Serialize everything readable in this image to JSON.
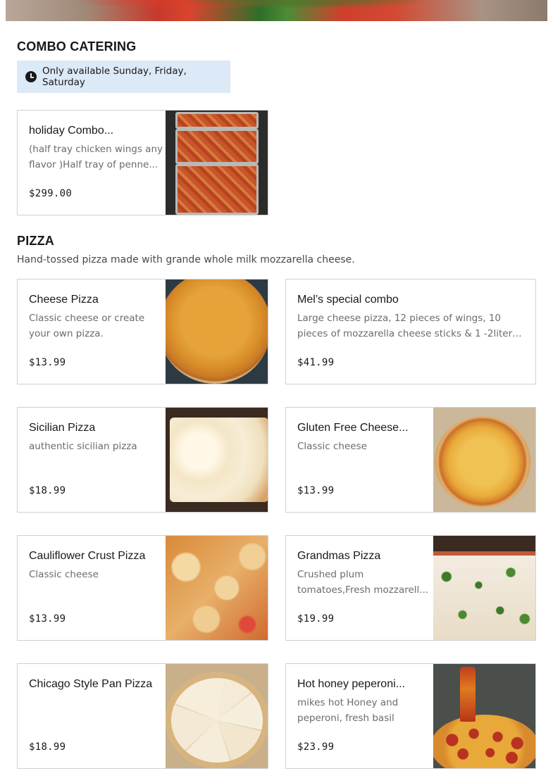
{
  "hero_image": "pizza-banner-image",
  "combo_section": {
    "title": "COMBO CATERING",
    "availability": "Only available Sunday, Friday, Saturday",
    "items": [
      {
        "name": "holiday Combo...",
        "desc": "(half tray chicken wings any flavor )Half tray of penne...",
        "price": "$299.00",
        "photo": "catering-trays-photo"
      }
    ]
  },
  "pizza_section": {
    "title": "PIZZA",
    "description": "Hand-tossed pizza made with grande whole milk mozzarella cheese.",
    "items": [
      {
        "name": "Cheese Pizza",
        "desc": "Classic cheese or create your own pizza.",
        "price": "$13.99",
        "photo": "cheese-pizza-photo"
      },
      {
        "name": "Mel’s special combo",
        "desc": "Large cheese pizza, 12 pieces of wings, 10 pieces of mozzarella cheese sticks & 1 -2liter soda....",
        "price": "$41.99"
      },
      {
        "name": "Sicilian Pizza",
        "desc": "authentic sicilian pizza",
        "price": "$18.99",
        "photo": "sicilian-pizza-photo"
      },
      {
        "name": "Gluten Free Cheese...",
        "desc": "Classic cheese",
        "price": "$13.99",
        "photo": "gluten-free-pizza-photo"
      },
      {
        "name": "Cauliflower Crust Pizza",
        "desc": "Classic cheese",
        "price": "$13.99",
        "photo": "cauliflower-pizza-photo"
      },
      {
        "name": "Grandmas Pizza",
        "desc": "Crushed plum tomatoes,Fresh mozzarell...",
        "price": "$19.99",
        "photo": "grandmas-pizza-photo"
      },
      {
        "name": "Chicago Style Pan Pizza",
        "desc": "",
        "price": "$18.99",
        "photo": "chicago-pizza-photo"
      },
      {
        "name": "Hot honey peperoni...",
        "desc": "mikes hot Honey and peperoni, fresh basil",
        "price": "$23.99",
        "photo": "hot-honey-pizza-photo"
      }
    ]
  }
}
